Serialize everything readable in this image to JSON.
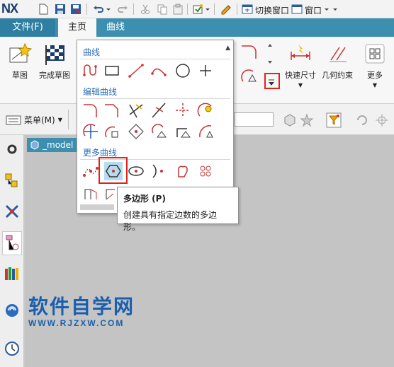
{
  "app": {
    "logo": "NX"
  },
  "quick_access": {
    "switch_window": "切换窗口",
    "window_menu": "窗口"
  },
  "tabs": [
    {
      "label": "文件(F)"
    },
    {
      "label": "主页"
    },
    {
      "label": "曲线"
    }
  ],
  "ribbon": {
    "sketch": "草图",
    "finish_sketch": "完成草图",
    "rapid_dimension": "快速尺寸",
    "geometric_constraints": "几何约束",
    "more": "更多"
  },
  "toolbar2": {
    "menu_label": "菜单(M)"
  },
  "viewport": {
    "document_tab": "_model"
  },
  "gallery": {
    "section_curve": "曲线",
    "section_edit_curve": "编辑曲线",
    "section_more_curve": "更多曲线",
    "selected_tool": "polygon-tool"
  },
  "tooltip": {
    "title": "多边形 (P)",
    "description": "创建具有指定边数的多边形。"
  },
  "watermark": {
    "main": "软件自学网",
    "url": "WWW.RJZXW.COM"
  },
  "colors": {
    "tab_bar": "#3d8fb0",
    "highlight_box": "#e0241b",
    "section_title": "#2d6fb5",
    "selected_tool_bg": "#b8dcef"
  }
}
